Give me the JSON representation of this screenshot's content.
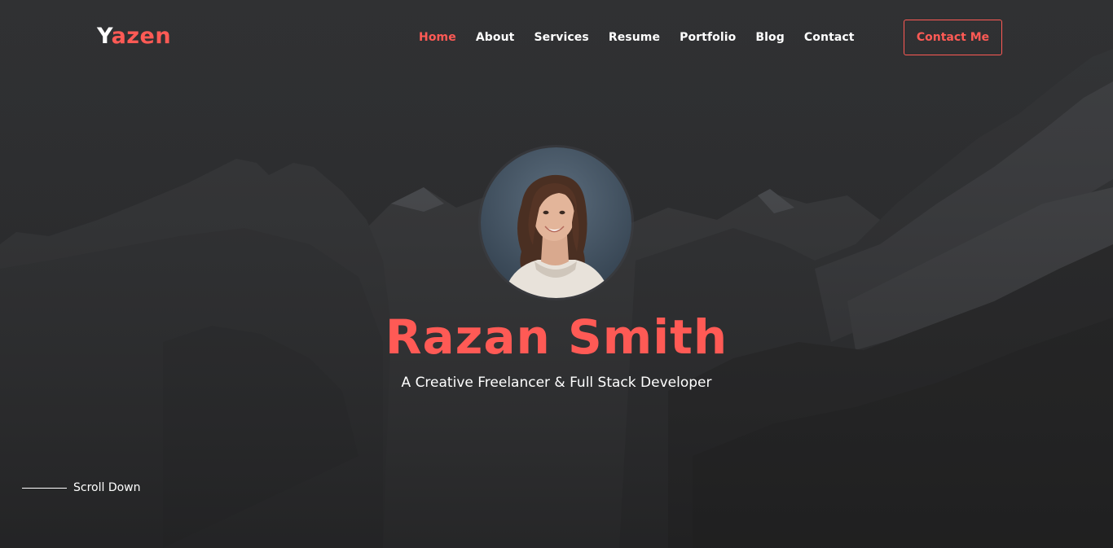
{
  "brand": {
    "first_letter": "Y",
    "rest": "azen"
  },
  "nav": {
    "items": [
      {
        "label": "Home",
        "active": true
      },
      {
        "label": "About"
      },
      {
        "label": "Services"
      },
      {
        "label": "Resume"
      },
      {
        "label": "Portfolio"
      },
      {
        "label": "Blog"
      },
      {
        "label": "Contact"
      }
    ],
    "cta_label": "Contact Me"
  },
  "hero": {
    "name": "Razan Smith",
    "tagline": "A Creative Freelancer & Full Stack Developer",
    "scroll_label": "Scroll Down"
  },
  "colors": {
    "accent": "#ff5a55",
    "background": "#2e2f31",
    "text": "#ffffff"
  }
}
